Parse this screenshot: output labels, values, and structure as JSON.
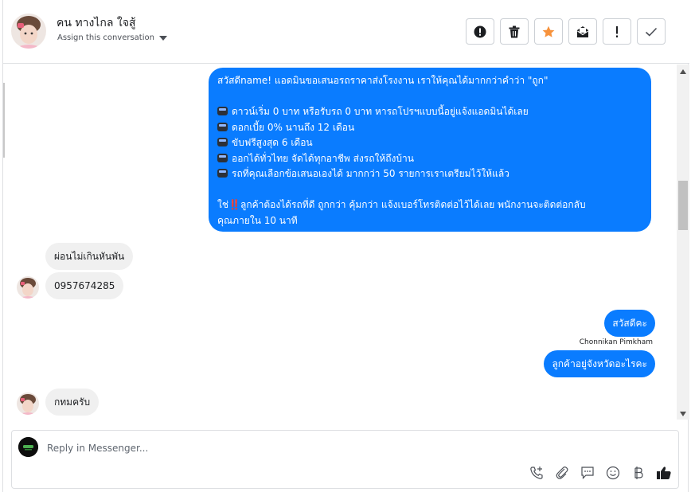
{
  "header": {
    "contact_name": "คน ทางไกล ใจสู้",
    "assign_label": "Assign this conversation",
    "actions": [
      "report-icon",
      "trash-icon",
      "star-icon",
      "mark-unread-icon",
      "important-icon",
      "check-icon"
    ]
  },
  "messages": {
    "offer": {
      "line1": "สวัสดีname! แอดมินขอเสนอรถราคาส่งโรงงาน เราให้คุณได้มากกว่าคำว่า \"ถูก\"",
      "bullet1": "ดาวน์เริ่ม 0 บาท หรือรับรถ 0 บาท หารถโปรฯแบบนี้อยู่แจ้งแอดมินได้เลย",
      "bullet2": "ดอกเบี้ย 0% นานถึง 12 เดือน",
      "bullet3": "ขับฟรีสูงสุด 6 เดือน",
      "bullet4": "ออกได้ทั่วไทย จัดได้ทุกอาชีพ ส่งรถให้ถึงบ้าน",
      "bullet5": "รถที่คุณเลือกข้อเสนอเองได้ มากกว่า 50 รายการเราเตรียมไว้ให้แล้ว",
      "closing_prefix": "ใช่",
      "closing_mark": "‼️",
      "closing_line1": "ลูกค้าต้องได้รถที่ดี ถูกกว่า คุ้มกว่า แจ้งเบอร์โทรติดต่อไว้ได้เลย พนักงานจะติดต่อกลับ",
      "closing_line2": "คุณภายใน 10 นาที"
    },
    "in1": "ผ่อนไม่เกินหันพัน",
    "in2": "0957674285",
    "out1": "สวัสดีคะ",
    "out1_sender": "Chonnikan Pimkham",
    "out2": "ลูกค้าอยู่จังหวัดอะไรคะ",
    "in3": "กทมครับ"
  },
  "composer": {
    "placeholder": "Reply in Messenger...",
    "tools": [
      "phone-add-icon",
      "attachment-icon",
      "saved-reply-icon",
      "emoji-icon",
      "baht-icon",
      "thumbs-up-icon"
    ]
  },
  "colors": {
    "outgoing": "#0a7cff",
    "incoming": "#f0f0f0",
    "star": "#f7923b"
  }
}
